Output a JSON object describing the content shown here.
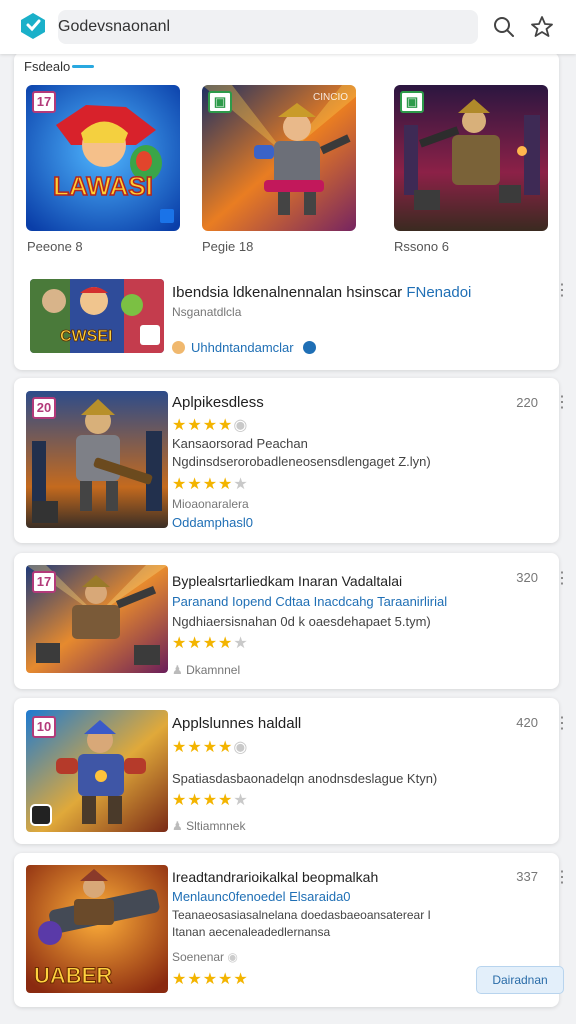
{
  "header": {
    "search_value": "Godevsnaonanl",
    "icons": [
      "app-logo-icon",
      "search-icon",
      "star-icon"
    ]
  },
  "featured": {
    "section_title": "Fsdealo",
    "items": [
      {
        "badge": "17",
        "tag": "",
        "label": "Peeone 8",
        "art_text": "LAWASI"
      },
      {
        "badge": "",
        "tag": "CINCIO",
        "label": "Pegie 18",
        "art_text": ""
      },
      {
        "badge": "",
        "tag": "",
        "label": "Rssono 6",
        "art_text": ""
      }
    ],
    "promo": {
      "title_a": "Ibendsia ldkenalnennalan hsinscar",
      "title_b": "FNenadoi",
      "subtitle": "Nsganatdlcla",
      "link": "Uhhdntandamclar",
      "art_text": "CWSEI"
    }
  },
  "list": [
    {
      "badge": "20",
      "number": "220",
      "title": "Aplpikesdless",
      "rating_1": 4,
      "line_1": "Kansaorsorad Peachan",
      "line_2": "Ngdinsdserorobadleneosensdlengaget Z.lyn)",
      "rating_2": 4,
      "line_3": "Mioaonaralera",
      "link": "Oddamphasl0"
    },
    {
      "badge": "17",
      "number": "320",
      "title": "Byplealsrtarliedkam Inaran Vadaltalai",
      "link_a": "Paranand Iopend Cdtaa Inacdcahg",
      "link_b": "Taraanirlirial",
      "line_1": "Ngdhiaersisnahan 0d k oaesdehapaet 5.tym)",
      "rating_1": 4,
      "meta": "Dkamnnel"
    },
    {
      "badge": "10",
      "number": "420",
      "title": "Applslunnes haldall",
      "rating_1": 4,
      "line_1": "Spatiasdasbaonadelqn anodnsdeslague Ktyn)",
      "rating_2": 4,
      "meta": "Sltiamnnek"
    },
    {
      "badge": "",
      "number": "337",
      "title": "Ireadtandrarioikalkal beopmalkah",
      "link_a": "Menlaunc0fenoedel",
      "link_b": "Elsaraida0",
      "line_1": "Teanaeosasiasalnelana doedasbaeoansaterear I",
      "line_2": "Itanan aecenaleadedlernansa",
      "line_3": "Soenenar",
      "rating_1": 5,
      "cta": "Dairadnan",
      "art_text": "UABER"
    }
  ],
  "colors": {
    "accent": "#29a8e0",
    "link": "#1f6fb5",
    "star": "#f3b400"
  }
}
